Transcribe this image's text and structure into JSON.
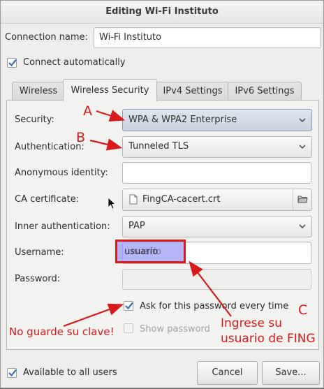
{
  "window": {
    "title": "Editing Wi-Fi Instituto"
  },
  "connection": {
    "name_label": "Connection name:",
    "name_value": "Wi-Fi Instituto",
    "auto_label": "Connect automatically"
  },
  "tabs": [
    {
      "label": "Wireless"
    },
    {
      "label": "Wireless Security"
    },
    {
      "label": "IPv4 Settings"
    },
    {
      "label": "IPv6 Settings"
    }
  ],
  "form": {
    "security_label": "Security:",
    "security_value": "WPA & WPA2 Enterprise",
    "auth_label": "Authentication:",
    "auth_value": "Tunneled TLS",
    "anon_label": "Anonymous identity:",
    "anon_value": "",
    "ca_label": "CA certificate:",
    "ca_value": "FingCA-cacert.crt",
    "inner_label": "Inner authentication:",
    "inner_value": "PAP",
    "user_label": "Username:",
    "user_value": "usuario",
    "pass_label": "Password:",
    "pass_value": "",
    "ask_label": "Ask for this password every time",
    "show_label": "Show password"
  },
  "footer": {
    "all_users_label": "Available to all users",
    "cancel_label": "Cancel",
    "save_label": "Save..."
  },
  "annotations": {
    "a": "A",
    "b": "B",
    "c": "C",
    "no_save": "No guarde su clave!",
    "enter_user_1": "Ingrese su",
    "enter_user_2": "usuario de FING"
  },
  "colors": {
    "annotation_red": "#d91a1a",
    "check_blue": "#3b6fb6",
    "highlight": "#b3b3f5"
  },
  "icons": [
    "chevron-down-icon",
    "file-icon",
    "folder-open-icon",
    "checkmark-icon",
    "mouse-cursor-icon"
  ]
}
